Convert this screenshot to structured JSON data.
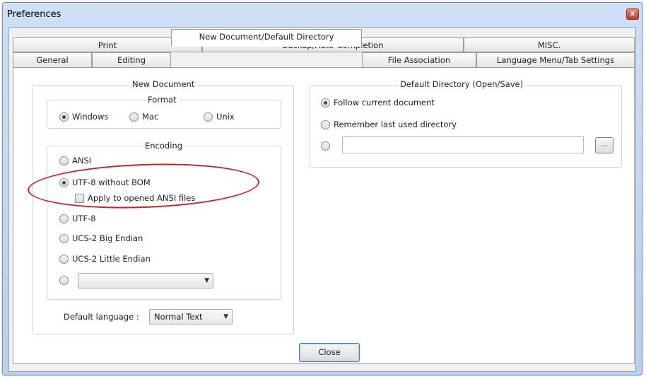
{
  "window": {
    "title": "Preferences",
    "close_glyph": "x"
  },
  "tabs_row_back": [
    {
      "label": "Print"
    },
    {
      "label": "Backup/Auto-Completion"
    },
    {
      "label": "MISC."
    }
  ],
  "tabs_row_front": [
    {
      "label": "General"
    },
    {
      "label": "Editing"
    },
    {
      "label": "New Document/Default Directory",
      "active": true
    },
    {
      "label": "File Association"
    },
    {
      "label": "Language Menu/Tab Settings"
    }
  ],
  "new_document": {
    "title": "New Document",
    "format": {
      "title": "Format",
      "options": [
        {
          "label": "Windows",
          "selected": true
        },
        {
          "label": "Mac",
          "selected": false
        },
        {
          "label": "Unix",
          "selected": false
        }
      ]
    },
    "encoding": {
      "title": "Encoding",
      "options": [
        {
          "label": "ANSI",
          "selected": false
        },
        {
          "label": "UTF-8 without BOM",
          "selected": true
        },
        {
          "label": "UTF-8",
          "selected": false
        },
        {
          "label": "UCS-2 Big Endian",
          "selected": false
        },
        {
          "label": "UCS-2 Little Endian",
          "selected": false
        }
      ],
      "apply_checkbox_label": "Apply to opened ANSI files",
      "apply_checked": false,
      "other_select_value": ""
    },
    "default_language_label": "Default language :",
    "default_language_value": "Normal Text"
  },
  "default_directory": {
    "title": "Default Directory (Open/Save)",
    "options": [
      {
        "label": "Follow current document",
        "selected": true
      },
      {
        "label": "Remember last used directory",
        "selected": false
      }
    ],
    "custom_path_value": "",
    "browse_label": "..."
  },
  "buttons": {
    "close_label": "Close"
  },
  "colors": {
    "annotation_ellipse": "#c4232b",
    "window_frame": "#b9cfea"
  },
  "icons": {
    "dropdown_arrow": "chevron-down-icon"
  }
}
